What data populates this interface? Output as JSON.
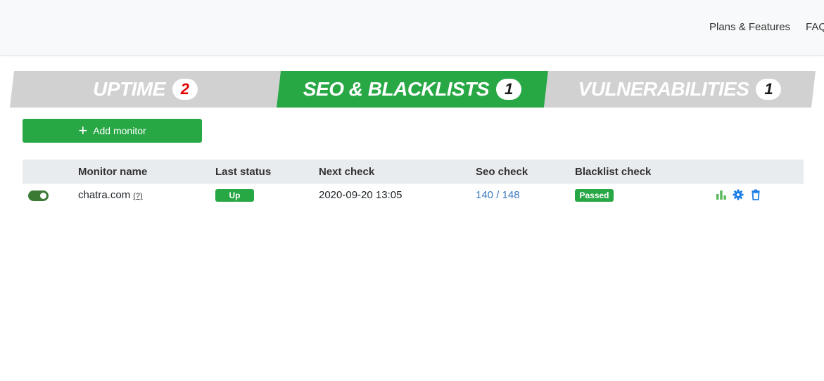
{
  "nav": {
    "plans_label": "Plans & Features",
    "faq_label": "FAQ"
  },
  "tabs": [
    {
      "label": "UPTIME",
      "count": "2"
    },
    {
      "label": "SEO & BLACKLISTS",
      "count": "1",
      "active": true
    },
    {
      "label": "VULNERABILITIES",
      "count": "1"
    }
  ],
  "toolbar": {
    "add_monitor_label": "Add monitor"
  },
  "table": {
    "columns": [
      "Monitor name",
      "Last status",
      "Next check",
      "Seo check",
      "Blacklist check"
    ],
    "rows": [
      {
        "enabled": true,
        "monitor_name": "chatra.com",
        "help": "(?)",
        "last_status": "Up",
        "next_check": "2020-09-20 13:05",
        "seo_check": "140 / 148",
        "blacklist_check": "Passed"
      }
    ]
  },
  "icons": [
    "bar-chart-icon",
    "gear-icon",
    "trash-icon"
  ],
  "colors": {
    "accent_green": "#28a745",
    "tab_inactive": "#d1d1d1",
    "link_blue": "#3a7abf",
    "icon_blue": "#1a7ee6",
    "uptime_count_red": "#e00000"
  }
}
